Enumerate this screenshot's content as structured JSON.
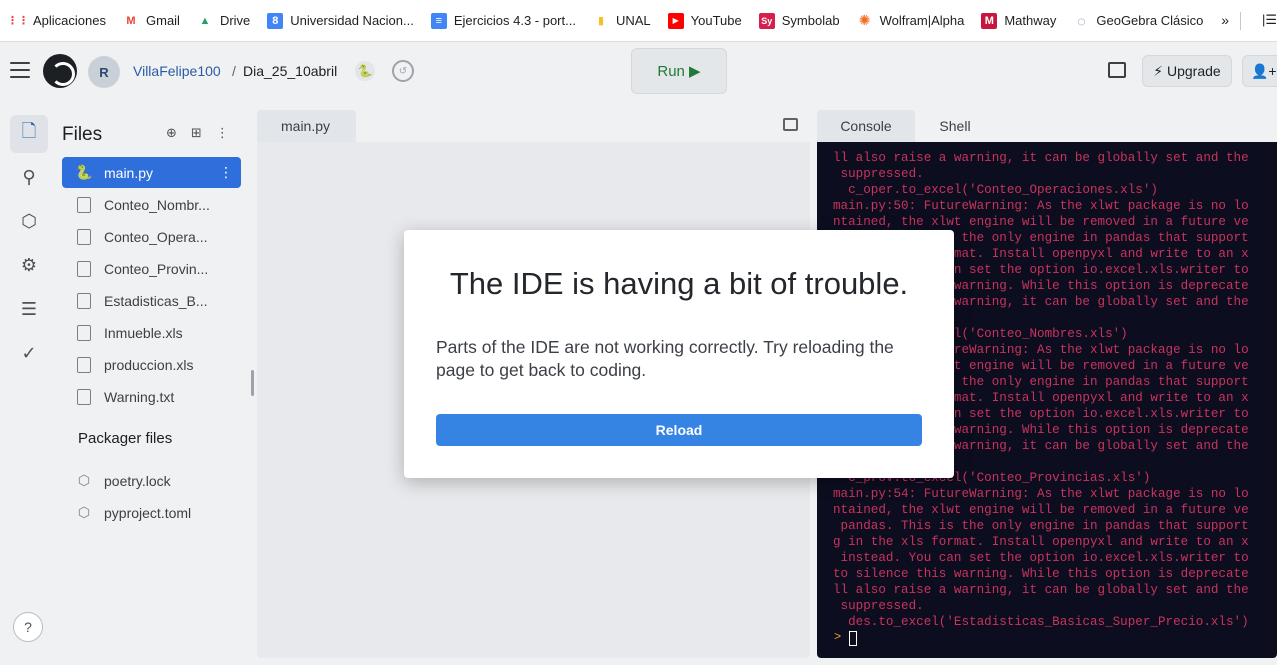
{
  "bookmarks": {
    "items": [
      {
        "label": "Aplicaciones",
        "icon": "apps-grid-icon",
        "icon_text": "⋮⋮",
        "color": "#e8453c"
      },
      {
        "label": "Gmail",
        "icon": "gmail-icon",
        "icon_text": "M",
        "color": "#ea4335"
      },
      {
        "label": "Drive",
        "icon": "drive-icon",
        "icon_text": "▲",
        "color": "#1fa463"
      },
      {
        "label": "Universidad Nacion...",
        "icon": "calendar-icon",
        "icon_text": "8",
        "color": "#4285f4"
      },
      {
        "label": "Ejercicios 4.3 - port...",
        "icon": "docs-icon",
        "icon_text": "≡",
        "color": "#4285f4"
      },
      {
        "label": "UNAL",
        "icon": "folder-icon",
        "icon_text": "▮",
        "color": "#f6c026"
      },
      {
        "label": "YouTube",
        "icon": "youtube-icon",
        "icon_text": "▶",
        "color": "#ff0000"
      },
      {
        "label": "Symbolab",
        "icon": "symbolab-icon",
        "icon_text": "Sy",
        "color": "#d5204f"
      },
      {
        "label": "Wolfram|Alpha",
        "icon": "wolfram-icon",
        "icon_text": "✺",
        "color": "#f36b21"
      },
      {
        "label": "Mathway",
        "icon": "mathway-icon",
        "icon_text": "M",
        "color": "#c7163f"
      },
      {
        "label": "GeoGebra Clásico",
        "icon": "geogebra-icon",
        "icon_text": "◌",
        "color": "#666699"
      }
    ],
    "more": "»",
    "list_icon": "|☰"
  },
  "header": {
    "avatar_text": "R",
    "user": "VillaFelipe100",
    "separator": "/",
    "repl_name": "Dia_25_10abril",
    "python_icon": "🐍",
    "history_icon": "↺",
    "run_label": "Run ▶",
    "upgrade_label": "⚡ Upgrade",
    "share_label": "👤+ S"
  },
  "rail": {
    "icons": [
      "files-icon",
      "git-icon",
      "packages-icon",
      "settings-icon",
      "database-icon",
      "checkmark-icon"
    ],
    "glyphs": [
      "🗋",
      "⚲",
      "⬡",
      "⚙",
      "☰",
      "✓"
    ],
    "help": "?"
  },
  "files": {
    "title": "Files",
    "tools": [
      "⊕",
      "⊞",
      "⋮"
    ],
    "items": [
      {
        "name": "main.py",
        "glyph": "🐍"
      },
      {
        "name": "Conteo_Nombr...",
        "glyph": ""
      },
      {
        "name": "Conteo_Opera...",
        "glyph": ""
      },
      {
        "name": "Conteo_Provin...",
        "glyph": ""
      },
      {
        "name": "Estadisticas_B...",
        "glyph": ""
      },
      {
        "name": "Inmueble.xls",
        "glyph": ""
      },
      {
        "name": "produccion.xls",
        "glyph": ""
      },
      {
        "name": "Warning.txt",
        "glyph": ""
      }
    ],
    "active_more": "⋮",
    "packager_title": "Packager files",
    "packager_items": [
      {
        "name": "poetry.lock",
        "glyph": "⬡"
      },
      {
        "name": "pyproject.toml",
        "glyph": "⬡"
      }
    ]
  },
  "editor": {
    "tab": "main.py"
  },
  "console": {
    "tabs": [
      "Console",
      "Shell"
    ],
    "output": "ll also raise a warning, it can be globally set and the\n suppressed.\n  c_oper.to_excel('Conteo_Operaciones.xls')\nmain.py:50: FutureWarning: As the xlwt package is no lo\nntained, the xlwt engine will be removed in a future ve\n pandas. This is the only engine in pandas that support\ng in the xls format. Install openpyxl and write to an x\n instead. You can set the option io.excel.xls.writer to\nto silence this warning. While this option is deprecate\nll also raise a warning, it can be globally set and the\n suppressed.\n  c_nomb.to_excel('Conteo_Nombres.xls')\nmain.py:52: FutureWarning: As the xlwt package is no lo\nntained, the xlwt engine will be removed in a future ve\n pandas. This is the only engine in pandas that support\ng in the xls format. Install openpyxl and write to an x\n instead. You can set the option io.excel.xls.writer to\nto silence this warning. While this option is deprecate\nll also raise a warning, it can be globally set and the\n suppressed.\n  c_prov.to_excel('Conteo_Provincias.xls')\nmain.py:54: FutureWarning: As the xlwt package is no lo\nntained, the xlwt engine will be removed in a future ve\n pandas. This is the only engine in pandas that support\ng in the xls format. Install openpyxl and write to an x\n instead. You can set the option io.excel.xls.writer to\nto silence this warning. While this option is deprecate\nll also raise a warning, it can be globally set and the\n suppressed.\n  des.to_excel('Estadisticas_Basicas_Super_Precio.xls')",
    "prompt": ">"
  },
  "modal": {
    "title": "The IDE is having a bit of trouble.",
    "message": "Parts of the IDE are not working correctly. Try reloading the page to get back to coding.",
    "button": "Reload"
  }
}
